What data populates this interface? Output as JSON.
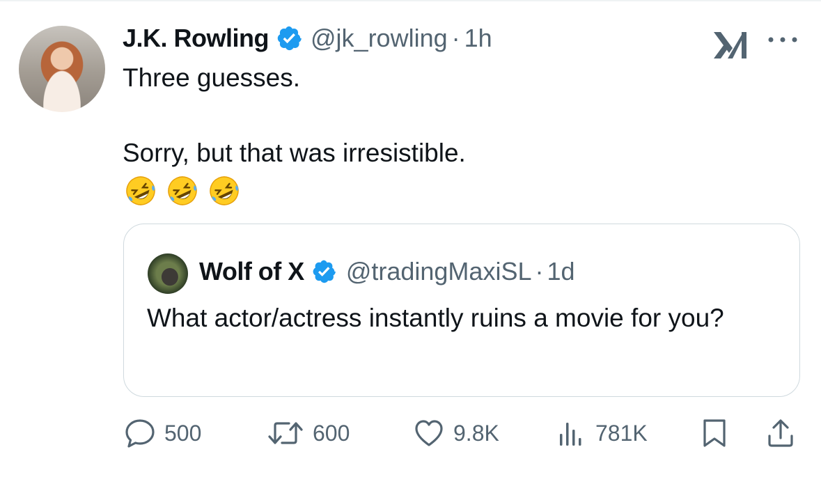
{
  "tweet": {
    "author_name": "J.K. Rowling",
    "handle": "@jk_rowling",
    "separator": "·",
    "time": "1h",
    "text_line1": "Three guesses.",
    "text_line2": "Sorry, but that was irresistible.",
    "emoji": [
      "rolling-on-floor-laughing",
      "rolling-on-floor-laughing",
      "rolling-on-floor-laughing"
    ]
  },
  "quoted": {
    "author_name": "Wolf of X",
    "handle": "@tradingMaxiSL",
    "separator": "·",
    "time": "1d",
    "text": "What actor/actress instantly ruins a movie for you?"
  },
  "actions": {
    "replies": "500",
    "reposts": "600",
    "likes": "9.8K",
    "views": "781K"
  },
  "icons": {
    "verified": "verified-badge-icon",
    "grok": "grok-icon",
    "more": "more-options-icon",
    "reply": "reply-icon",
    "repost": "repost-icon",
    "like": "heart-icon",
    "views": "views-chart-icon",
    "bookmark": "bookmark-icon",
    "share": "share-icon"
  },
  "colors": {
    "text": "#0f1419",
    "secondary": "#536471",
    "verified": "#1d9bf0",
    "border": "#cfd9de"
  }
}
